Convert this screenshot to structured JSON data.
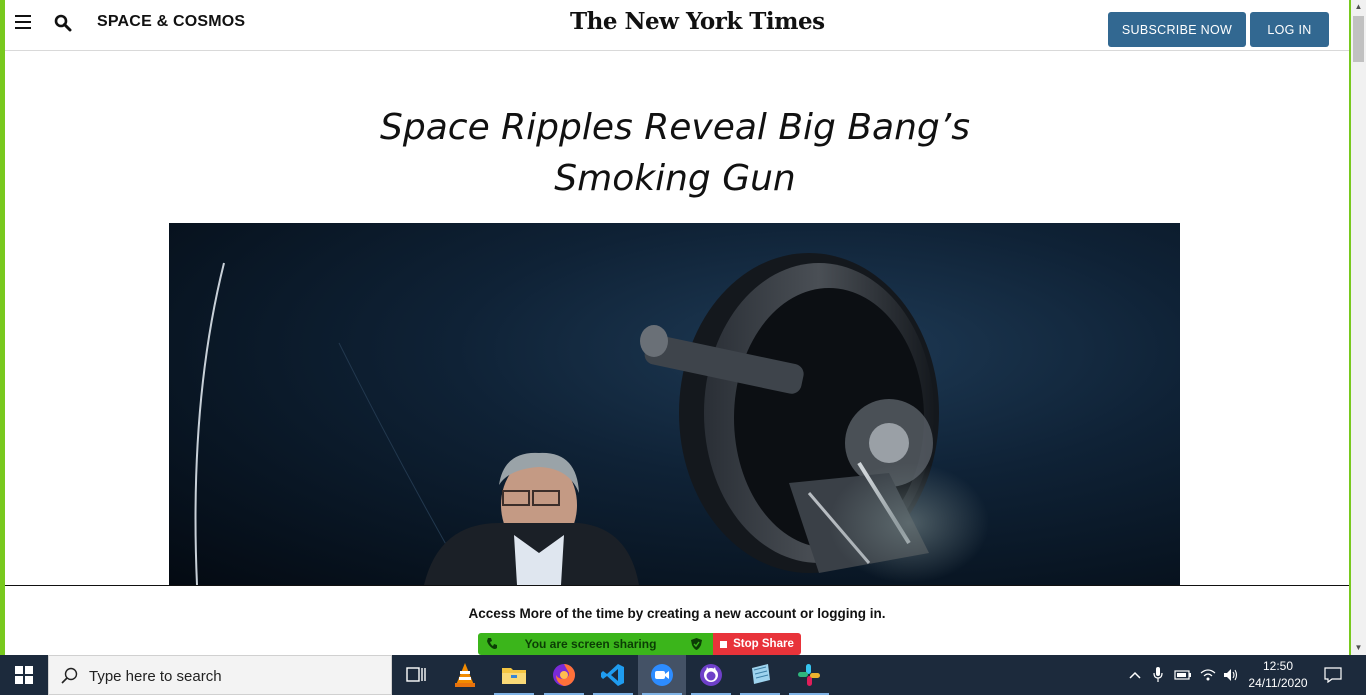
{
  "header": {
    "section": "SPACE & COSMOS",
    "masthead": "The New York Times",
    "subscribe_label": "SUBSCRIBE NOW",
    "login_label": "LOG IN"
  },
  "article": {
    "headline_line1": "Space Ripples Reveal Big Bang’s",
    "headline_line2": "Smoking Gun"
  },
  "signin_prompt": "Access More of the time by creating a new account or logging in.",
  "screen_share": {
    "status": "You are screen sharing",
    "stop_label": "Stop Share"
  },
  "taskbar": {
    "search_placeholder": "Type here to search",
    "apps": [
      "task-view",
      "vlc",
      "file-explorer",
      "firefox",
      "vscode",
      "zoom",
      "github-desktop",
      "notepad",
      "slack"
    ],
    "time": "12:50",
    "date": "24/11/2020"
  },
  "colors": {
    "frame": "#78c91e",
    "nyt_button": "#326891",
    "share_green": "#3bb51b",
    "stop_red": "#e8333a",
    "taskbar": "#1c2a3c"
  }
}
